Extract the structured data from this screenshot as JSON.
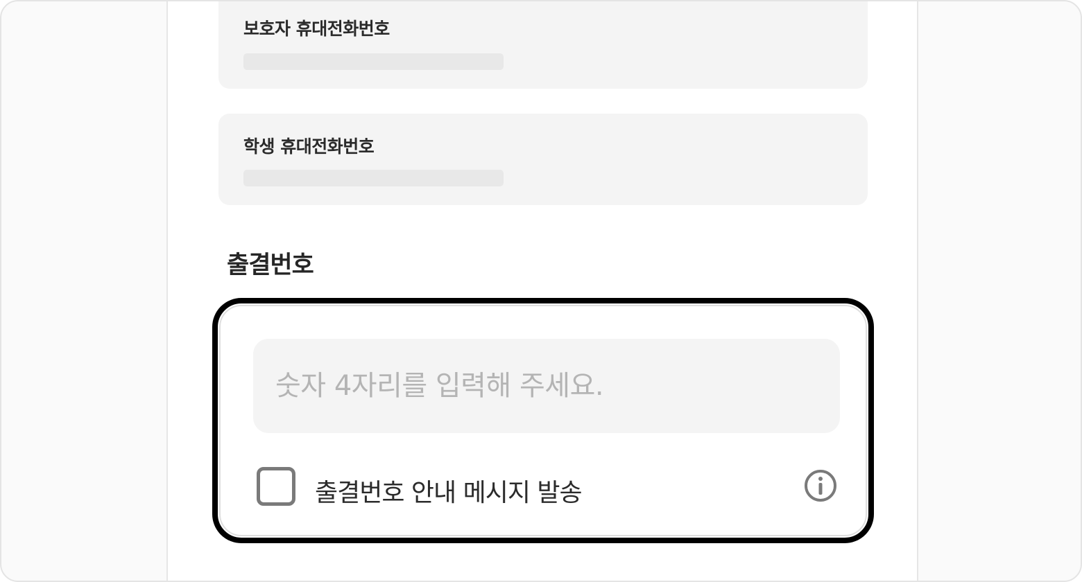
{
  "form": {
    "guardian_phone_label": "보호자 휴대전화번호",
    "student_phone_label": "학생 휴대전화번호"
  },
  "attendance": {
    "section_title": "출결번호",
    "input_value": "",
    "input_placeholder": "숫자 4자리를 입력해 주세요.",
    "checkbox_checked": false,
    "checkbox_label": "출결번호 안내 메시지 발송",
    "info_icon": "info-circle-icon"
  },
  "colors": {
    "focus_border": "#000000",
    "field_background": "#f4f4f4",
    "placeholder_text": "#b4b4b4",
    "icon": "#7a7a7a"
  }
}
